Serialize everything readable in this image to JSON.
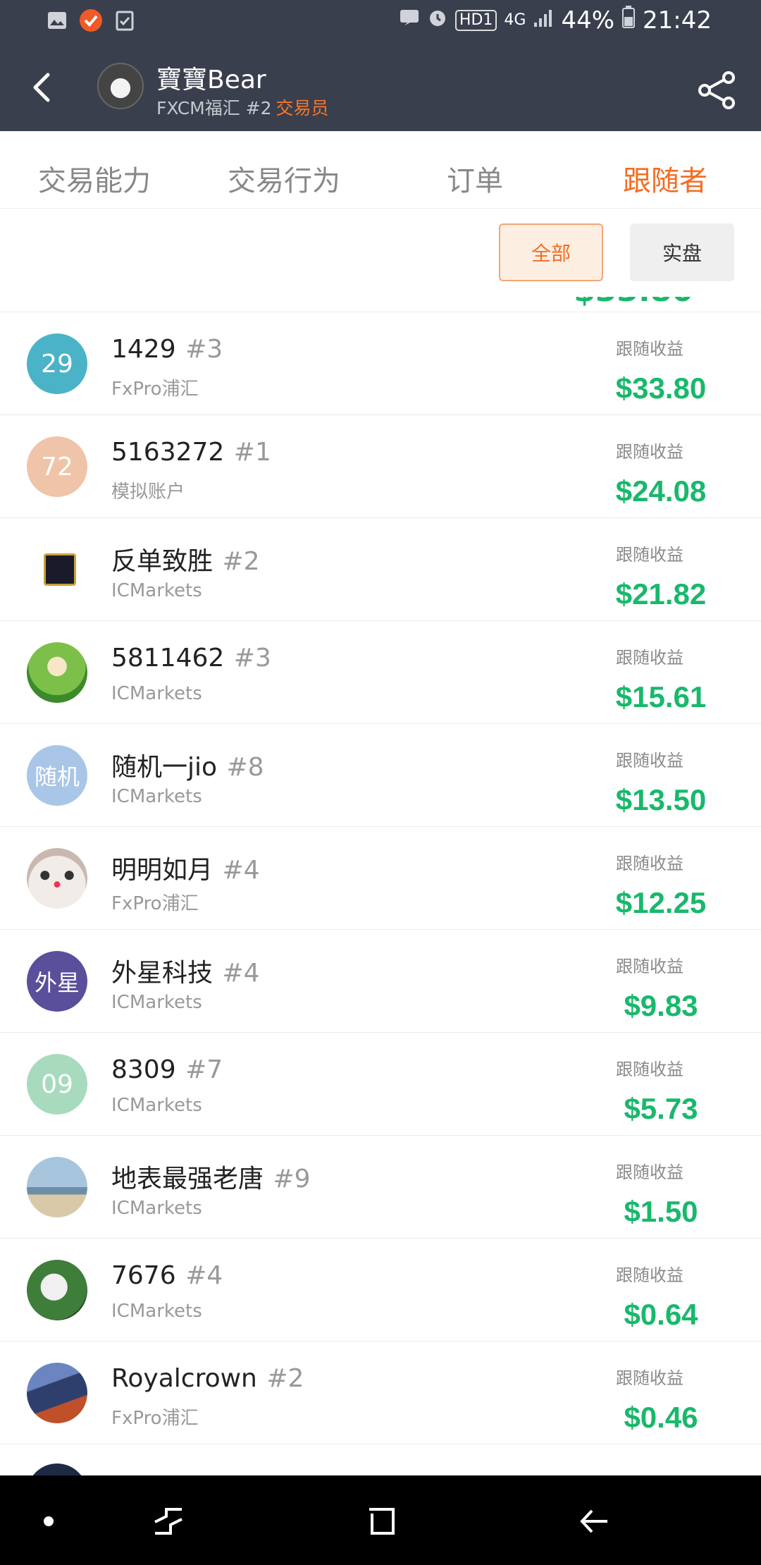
{
  "status_bar": {
    "battery": "44%",
    "time": "21:42",
    "network": "4G",
    "hd_badge": "HD1"
  },
  "header": {
    "name": "寶寶Bear",
    "subtitle": "FXCM福汇 #2",
    "role": "交易员",
    "accent_color": "#f36d22"
  },
  "tabs": [
    {
      "label": "交易能力"
    },
    {
      "label": "交易行为"
    },
    {
      "label": "订单"
    },
    {
      "label": "跟随者"
    }
  ],
  "filters": {
    "all": "全部",
    "live": "实盘"
  },
  "followers": [
    {
      "avatar_text": "29",
      "avatar_color": "#4bb3c8",
      "name": "1429",
      "rank": "#3",
      "broker": "FxPro浦汇",
      "label": "跟随收益",
      "value": "$33.80"
    },
    {
      "avatar_text": "72",
      "avatar_color": "#efc4a8",
      "name": "5163272",
      "rank": "#1",
      "broker": "模拟账户",
      "label": "跟随收益",
      "value": "$24.08"
    },
    {
      "avatar_text": "",
      "avatar_color": "#1a1a2a",
      "name": "反单致胜",
      "rank": "#2",
      "broker": "ICMarkets",
      "label": "跟随收益",
      "value": "$21.82"
    },
    {
      "avatar_text": "",
      "avatar_color": "#6aa84f",
      "name": "5811462",
      "rank": "#3",
      "broker": "ICMarkets",
      "label": "跟随收益",
      "value": "$15.61"
    },
    {
      "avatar_text": "随机",
      "avatar_color": "#a9c6e8",
      "name": "随机一jio",
      "rank": "#8",
      "broker": "ICMarkets",
      "label": "跟随收益",
      "value": "$13.50"
    },
    {
      "avatar_text": "",
      "avatar_color": "#d9c7c2",
      "name": "明明如月",
      "rank": "#4",
      "broker": "FxPro浦汇",
      "label": "跟随收益",
      "value": "$12.25"
    },
    {
      "avatar_text": "外星",
      "avatar_color": "#5a4f9a",
      "name": "外星科技",
      "rank": "#4",
      "broker": "ICMarkets",
      "label": "跟随收益",
      "value": "$9.83"
    },
    {
      "avatar_text": "09",
      "avatar_color": "#a8dbbe",
      "name": "8309",
      "rank": "#7",
      "broker": "ICMarkets",
      "label": "跟随收益",
      "value": "$5.73"
    },
    {
      "avatar_text": "",
      "avatar_color": "#a7c6dd",
      "name": "地表最强老唐",
      "rank": "#9",
      "broker": "ICMarkets",
      "label": "跟随收益",
      "value": "$1.50"
    },
    {
      "avatar_text": "",
      "avatar_color": "#3f7d3a",
      "name": "7676",
      "rank": "#4",
      "broker": "ICMarkets",
      "label": "跟随收益",
      "value": "$0.64"
    },
    {
      "avatar_text": "",
      "avatar_color": "#2e3f6e",
      "name": "Royalcrown",
      "rank": "#2",
      "broker": "FxPro浦汇",
      "label": "跟随收益",
      "value": "$0.46"
    }
  ],
  "colors": {
    "profit_green": "#19b86c",
    "header_bg": "#3a3f4d"
  }
}
